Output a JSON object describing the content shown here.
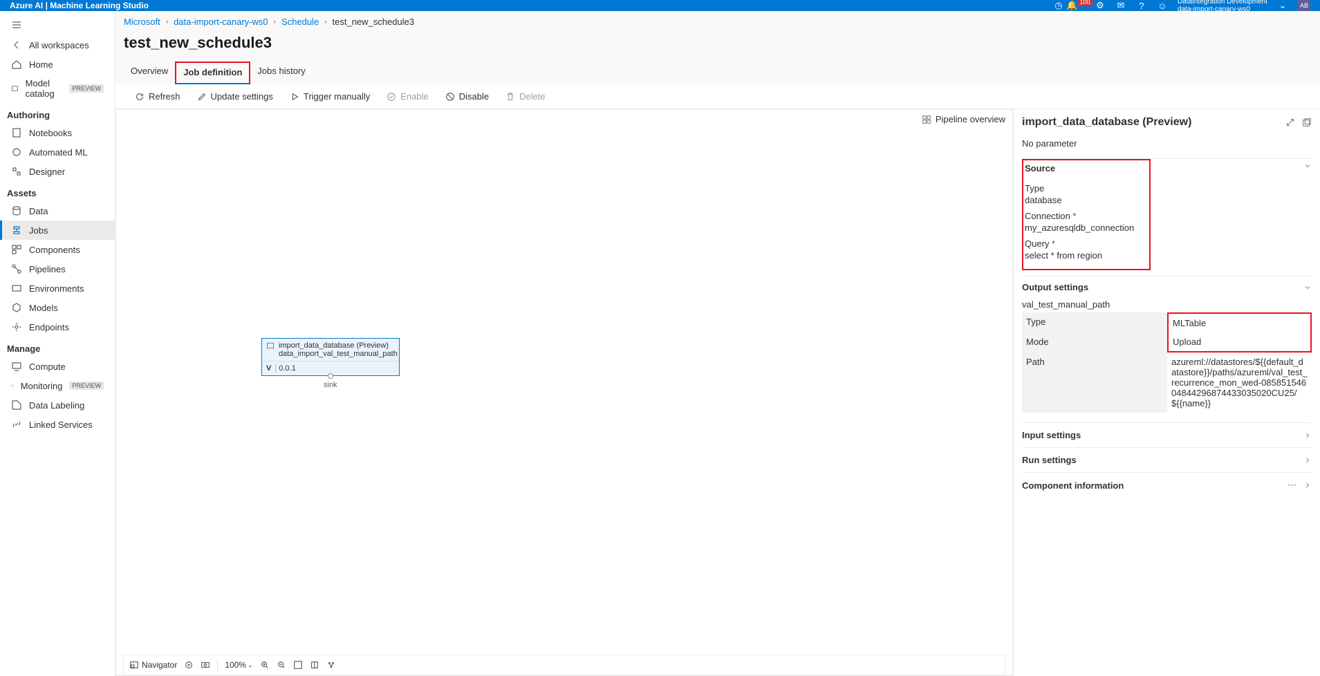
{
  "top": {
    "title": "Azure AI | Machine Learning Studio",
    "badge_count": "100",
    "workspace_line1": "DataIntegration Development",
    "workspace_line2": "data-import-canary-ws0",
    "avatar": "AB"
  },
  "sidebar": {
    "all_workspaces": "All workspaces",
    "main_items": [
      {
        "label": "Home"
      },
      {
        "label": "Model catalog",
        "preview": "PREVIEW"
      }
    ],
    "sections": {
      "authoring": "Authoring",
      "authoring_items": [
        "Notebooks",
        "Automated ML",
        "Designer"
      ],
      "assets": "Assets",
      "assets_items": [
        "Data",
        "Jobs",
        "Components",
        "Pipelines",
        "Environments",
        "Models",
        "Endpoints"
      ],
      "manage": "Manage",
      "manage_items": [
        "Compute",
        "Monitoring",
        "Data Labeling",
        "Linked Services"
      ],
      "monitoring_preview": "PREVIEW"
    }
  },
  "breadcrumbs": {
    "items": [
      "Microsoft",
      "data-import-canary-ws0",
      "Schedule",
      "test_new_schedule3"
    ]
  },
  "page_title": "test_new_schedule3",
  "tabs": {
    "items": [
      "Overview",
      "Job definition",
      "Jobs history"
    ],
    "active": 1
  },
  "toolbar": {
    "refresh": "Refresh",
    "update_settings": "Update settings",
    "trigger_manually": "Trigger manually",
    "enable": "Enable",
    "disable": "Disable",
    "delete": "Delete"
  },
  "pipeline_overview": "Pipeline overview",
  "node": {
    "title": "import_data_database (Preview)",
    "subtitle": "data_import_val_test_manual_path",
    "version_label": "V",
    "version": "0.0.1",
    "sink": "sink"
  },
  "canvas_footer": {
    "navigator": "Navigator",
    "zoom": "100%"
  },
  "right_panel": {
    "title": "import_data_database (Preview)",
    "no_parameter": "No parameter",
    "source": {
      "header": "Source",
      "type_label": "Type",
      "type_value": "database",
      "conn_label": "Connection",
      "conn_value": "my_azuresqldb_connection",
      "query_label": "Query",
      "query_value": "select * from region"
    },
    "output": {
      "header": "Output settings",
      "name": "val_test_manual_path",
      "rows": {
        "type_label": "Type",
        "type_value": "MLTable",
        "mode_label": "Mode",
        "mode_value": "Upload",
        "path_label": "Path",
        "path_value": "azureml://datastores/${{default_datastore}}/paths/azureml/val_test_recurrence_mon_wed-085851546048442968744330350​20CU25/${{name}}"
      }
    },
    "input_settings": "Input settings",
    "run_settings": "Run settings",
    "component_info": "Component information"
  }
}
